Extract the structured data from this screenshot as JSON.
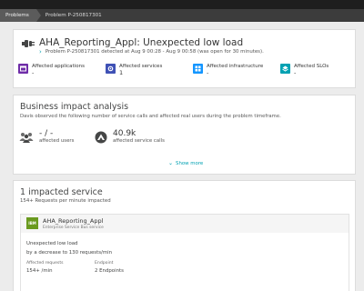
{
  "breadcrumb": [
    "Problems",
    "Problem P-250817301"
  ],
  "problem": {
    "title": "AHA_Reporting_Appl: Unexpected low load",
    "subtitle": "Problem P-250817301 detected at Aug 9 00:28 - Aug 9 00:58 (was open for 30 minutes)."
  },
  "metrics": [
    {
      "label": "Affected applications",
      "value": "-",
      "icon": "applications-icon",
      "color": "#6f2da8"
    },
    {
      "label": "Affected services",
      "value": "1",
      "icon": "services-icon",
      "color": "#3f51b5"
    },
    {
      "label": "Affected infrastructure",
      "value": "-",
      "icon": "infrastructure-icon",
      "color": "#1496ff"
    },
    {
      "label": "Affected SLOs",
      "value": "-",
      "icon": "slo-icon",
      "color": "#00a1b2"
    }
  ],
  "impact": {
    "title": "Business impact analysis",
    "description": "Davis observed the following number of service calls and affected real users during the problem timeframe.",
    "users_value": "- / -",
    "users_label": "affected users",
    "calls_value": "40.9k",
    "calls_label": "affected service calls",
    "show_more": "Show more"
  },
  "services": {
    "title": "1 impacted service",
    "subtitle": "154+ Requests per minute impacted",
    "item": {
      "logo": "IBM",
      "name": "AHA_Reporting_Appl",
      "type": "Enterprise Service Bus service",
      "issue": "Unexpected low load",
      "issue_detail": "by a decrease to 130 requests/min",
      "requests_label": "Affected requests",
      "requests_value": "154+ /min",
      "endpoint_label": "Endpoint",
      "endpoint_value": "2 Endpoints"
    }
  }
}
